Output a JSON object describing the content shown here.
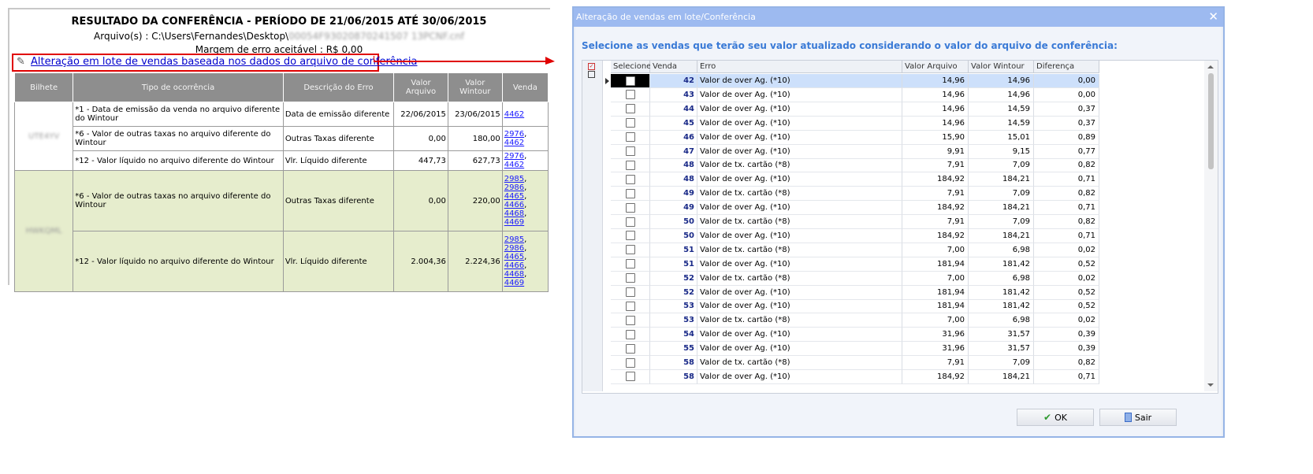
{
  "report": {
    "title": "RESULTADO DA CONFERÊNCIA - PERÍODO DE 21/06/2015 ATÉ 30/06/2015",
    "file_label": "Arquivo(s) : C:\\Users\\Fernandes\\Desktop\\",
    "file_name": "00054F93020870241507 13PCNF.cnf",
    "margin_text": "Margem de erro aceitável : R$ 0,00",
    "batch_link": "Alteração em lote de vendas baseada nos dados do arquivo de conferência",
    "headers": {
      "bilhete": "Bilhete",
      "tipo": "Tipo de ocorrência",
      "descricao": "Descrição do Erro",
      "valor_arquivo": "Valor Arquivo",
      "valor_wintour": "Valor Wintour",
      "venda": "Venda"
    },
    "groups": [
      {
        "bilhete": "UTE4YV",
        "rows": [
          {
            "tipo": "*1 - Data de emissão da venda no arquivo diferente do Wintour",
            "descricao": "Data de emissão diferente",
            "valor_arquivo": "22/06/2015",
            "valor_wintour": "23/06/2015",
            "vendas": [
              "4462"
            ]
          },
          {
            "tipo": "*6 - Valor de outras taxas no arquivo diferente do Wintour",
            "descricao": "Outras Taxas diferente",
            "valor_arquivo": "0,00",
            "valor_wintour": "180,00",
            "vendas": [
              "2976",
              "4462"
            ]
          },
          {
            "tipo": "*12 - Valor líquido no arquivo diferente do Wintour",
            "descricao": "Vlr. Líquido diferente",
            "valor_arquivo": "447,73",
            "valor_wintour": "627,73",
            "vendas": [
              "2976",
              "4462"
            ]
          }
        ]
      },
      {
        "bilhete": "HWKQML",
        "rows": [
          {
            "tipo": "*6 - Valor de outras taxas no arquivo diferente do Wintour",
            "descricao": "Outras Taxas diferente",
            "valor_arquivo": "0,00",
            "valor_wintour": "220,00",
            "vendas": [
              "2985",
              "2986",
              "4465",
              "4466",
              "4468",
              "4469"
            ]
          },
          {
            "tipo": "*12 - Valor líquido no arquivo diferente do Wintour",
            "descricao": "Vlr. Líquido diferente",
            "valor_arquivo": "2.004,36",
            "valor_wintour": "2.224,36",
            "vendas": [
              "2985",
              "2986",
              "4465",
              "4466",
              "4468",
              "4469"
            ]
          }
        ]
      }
    ]
  },
  "dialog": {
    "title": "Alteração de vendas em lote/Conferência",
    "close": "✕",
    "instruction": "Selecione as vendas que terão seu valor atualizado considerando o valor do arquivo de conferência:",
    "columns": {
      "selecione": "Selecione",
      "venda": "Venda",
      "erro": "Erro",
      "valor_arquivo": "Valor Arquivo",
      "valor_wintour": "Valor Wintour",
      "diferenca": "Diferença"
    },
    "rows": [
      {
        "venda": "42",
        "erro": "Valor de over Ag. (*10)",
        "valor_arquivo": "14,96",
        "valor_wintour": "14,96",
        "diferenca": "0,00",
        "selected": true
      },
      {
        "venda": "43",
        "erro": "Valor de over Ag. (*10)",
        "valor_arquivo": "14,96",
        "valor_wintour": "14,96",
        "diferenca": "0,00"
      },
      {
        "venda": "44",
        "erro": "Valor de over Ag. (*10)",
        "valor_arquivo": "14,96",
        "valor_wintour": "14,59",
        "diferenca": "0,37"
      },
      {
        "venda": "45",
        "erro": "Valor de over Ag. (*10)",
        "valor_arquivo": "14,96",
        "valor_wintour": "14,59",
        "diferenca": "0,37"
      },
      {
        "venda": "46",
        "erro": "Valor de over Ag. (*10)",
        "valor_arquivo": "15,90",
        "valor_wintour": "15,01",
        "diferenca": "0,89"
      },
      {
        "venda": "47",
        "erro": "Valor de over Ag. (*10)",
        "valor_arquivo": "9,91",
        "valor_wintour": "9,15",
        "diferenca": "0,77"
      },
      {
        "venda": "48",
        "erro": "Valor de tx. cartão (*8)",
        "valor_arquivo": "7,91",
        "valor_wintour": "7,09",
        "diferenca": "0,82"
      },
      {
        "venda": "48",
        "erro": "Valor de over Ag. (*10)",
        "valor_arquivo": "184,92",
        "valor_wintour": "184,21",
        "diferenca": "0,71"
      },
      {
        "venda": "49",
        "erro": "Valor de tx. cartão (*8)",
        "valor_arquivo": "7,91",
        "valor_wintour": "7,09",
        "diferenca": "0,82"
      },
      {
        "venda": "49",
        "erro": "Valor de over Ag. (*10)",
        "valor_arquivo": "184,92",
        "valor_wintour": "184,21",
        "diferenca": "0,71"
      },
      {
        "venda": "50",
        "erro": "Valor de tx. cartão (*8)",
        "valor_arquivo": "7,91",
        "valor_wintour": "7,09",
        "diferenca": "0,82"
      },
      {
        "venda": "50",
        "erro": "Valor de over Ag. (*10)",
        "valor_arquivo": "184,92",
        "valor_wintour": "184,21",
        "diferenca": "0,71"
      },
      {
        "venda": "51",
        "erro": "Valor de tx. cartão (*8)",
        "valor_arquivo": "7,00",
        "valor_wintour": "6,98",
        "diferenca": "0,02"
      },
      {
        "venda": "51",
        "erro": "Valor de over Ag. (*10)",
        "valor_arquivo": "181,94",
        "valor_wintour": "181,42",
        "diferenca": "0,52"
      },
      {
        "venda": "52",
        "erro": "Valor de tx. cartão (*8)",
        "valor_arquivo": "7,00",
        "valor_wintour": "6,98",
        "diferenca": "0,02"
      },
      {
        "venda": "52",
        "erro": "Valor de over Ag. (*10)",
        "valor_arquivo": "181,94",
        "valor_wintour": "181,42",
        "diferenca": "0,52"
      },
      {
        "venda": "53",
        "erro": "Valor de over Ag. (*10)",
        "valor_arquivo": "181,94",
        "valor_wintour": "181,42",
        "diferenca": "0,52"
      },
      {
        "venda": "53",
        "erro": "Valor de tx. cartão (*8)",
        "valor_arquivo": "7,00",
        "valor_wintour": "6,98",
        "diferenca": "0,02"
      },
      {
        "venda": "54",
        "erro": "Valor de over Ag. (*10)",
        "valor_arquivo": "31,96",
        "valor_wintour": "31,57",
        "diferenca": "0,39"
      },
      {
        "venda": "55",
        "erro": "Valor de over Ag. (*10)",
        "valor_arquivo": "31,96",
        "valor_wintour": "31,57",
        "diferenca": "0,39"
      },
      {
        "venda": "58",
        "erro": "Valor de tx. cartão (*8)",
        "valor_arquivo": "7,91",
        "valor_wintour": "7,09",
        "diferenca": "0,82"
      },
      {
        "venda": "58",
        "erro": "Valor de over Ag. (*10)",
        "valor_arquivo": "184,92",
        "valor_wintour": "184,21",
        "diferenca": "0,71"
      }
    ],
    "ok_label": "OK",
    "exit_label": "Sair"
  },
  "icons": {
    "pencil": "pencil-icon",
    "close": "close-icon",
    "check": "check-icon",
    "exit": "exit-door-icon"
  },
  "colors": {
    "link_box_border": "#e00000",
    "dialog_title_bar": "#9dbaf0",
    "instruction_text": "#3a7ad6",
    "report_header": "#8e8e8e",
    "report_group_green": "#e6edcd",
    "selected_row": "#cde0fb"
  }
}
